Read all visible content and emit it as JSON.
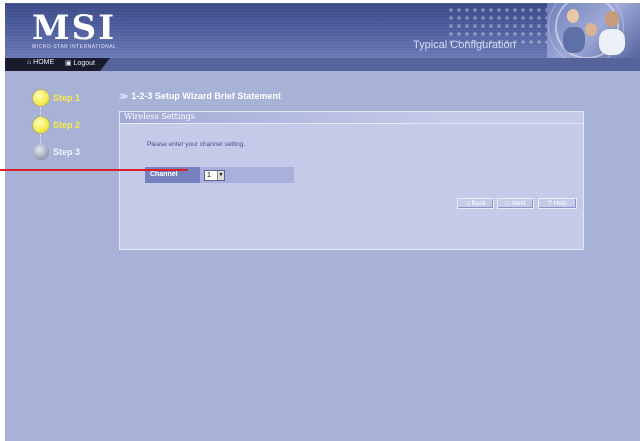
{
  "header": {
    "logo": "MSI",
    "tagline": "MICRO-STAR INTERNATIONAL",
    "config_title": "Typical Configuration"
  },
  "nav": {
    "home": "⌂ HOME",
    "logout": "▣ Logout"
  },
  "steps": [
    {
      "label": "Step 1",
      "state": "active"
    },
    {
      "label": "Step 2",
      "state": "active"
    },
    {
      "label": "Step 3",
      "state": "inactive"
    }
  ],
  "breadcrumb": "1-2-3 Setup Wizard Brief Statement",
  "panel": {
    "title": "Wireless Settings",
    "instruction": "Please enter your channel setting.",
    "channel_label": "Channel",
    "channel_value": "1"
  },
  "buttons": {
    "back": "◁ Back",
    "next": "▷ Next",
    "help": "? Help"
  },
  "colors": {
    "background": "#a8b2d6",
    "header": "#4c5c9c",
    "step_active": "#f4ea4a",
    "pointer_line": "#d8202a"
  }
}
